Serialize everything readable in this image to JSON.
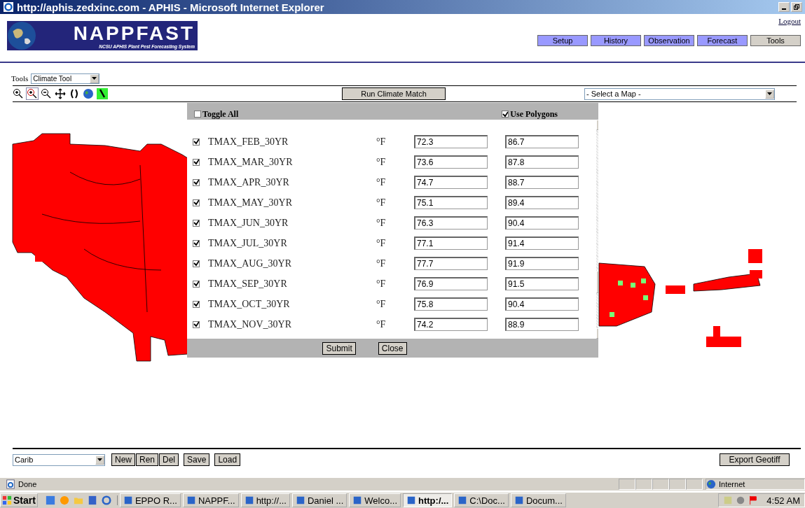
{
  "window": {
    "title": "http://aphis.zedxinc.com - APHIS - Microsoft Internet Explorer"
  },
  "header": {
    "logo_title": "NAPPFAST",
    "logo_subtitle": "NCSU APHIS Plant Pest Forecasting System",
    "logout": "Logout"
  },
  "tabs": [
    {
      "label": "Setup",
      "selected": false
    },
    {
      "label": "History",
      "selected": false
    },
    {
      "label": "Observation",
      "selected": false
    },
    {
      "label": "Forecast",
      "selected": false
    },
    {
      "label": "Tools",
      "selected": true
    }
  ],
  "tools": {
    "label": "Tools",
    "value": "Climate Tool"
  },
  "toolbar": {
    "run_button": "Run Climate Match",
    "map_select": "- Select a Map -"
  },
  "dialog": {
    "toggle_all": {
      "label": "Toggle All",
      "checked": false
    },
    "use_polygons": {
      "label": "Use Polygons",
      "checked": true
    },
    "rows": [
      {
        "name": "TMAX_FEB_30YR",
        "checked": true,
        "unit": "°F",
        "min": "72.3",
        "max": "86.7"
      },
      {
        "name": "TMAX_MAR_30YR",
        "checked": true,
        "unit": "°F",
        "min": "73.6",
        "max": "87.8"
      },
      {
        "name": "TMAX_APR_30YR",
        "checked": true,
        "unit": "°F",
        "min": "74.7",
        "max": "88.7"
      },
      {
        "name": "TMAX_MAY_30YR",
        "checked": true,
        "unit": "°F",
        "min": "75.1",
        "max": "89.4"
      },
      {
        "name": "TMAX_JUN_30YR",
        "checked": true,
        "unit": "°F",
        "min": "76.3",
        "max": "90.4"
      },
      {
        "name": "TMAX_JUL_30YR",
        "checked": true,
        "unit": "°F",
        "min": "77.1",
        "max": "91.4"
      },
      {
        "name": "TMAX_AUG_30YR",
        "checked": true,
        "unit": "°F",
        "min": "77.7",
        "max": "91.9"
      },
      {
        "name": "TMAX_SEP_30YR",
        "checked": true,
        "unit": "°F",
        "min": "76.9",
        "max": "91.5"
      },
      {
        "name": "TMAX_OCT_30YR",
        "checked": true,
        "unit": "°F",
        "min": "75.8",
        "max": "90.4"
      },
      {
        "name": "TMAX_NOV_30YR",
        "checked": true,
        "unit": "°F",
        "min": "74.2",
        "max": "88.9"
      }
    ],
    "buttons": [
      "Submit",
      "Close"
    ]
  },
  "bottom": {
    "region": "Carib",
    "buttons": [
      "New",
      "Ren",
      "Del",
      "Save",
      "Load"
    ],
    "export": "Export Geotiff"
  },
  "status_bar": {
    "text": "Done",
    "zone": "Internet"
  },
  "taskbar": {
    "start": "Start",
    "items": [
      {
        "label": "EPPO R...",
        "selected": false
      },
      {
        "label": "NAPPF...",
        "selected": false
      },
      {
        "label": "http://...",
        "selected": false
      },
      {
        "label": "Daniel ...",
        "selected": false
      },
      {
        "label": "Welco...",
        "selected": false
      },
      {
        "label": "http:/...",
        "selected": true
      },
      {
        "label": "C:\\Doc...",
        "selected": false
      },
      {
        "label": "Docum...",
        "selected": false
      }
    ],
    "clock": "4:52 AM"
  }
}
